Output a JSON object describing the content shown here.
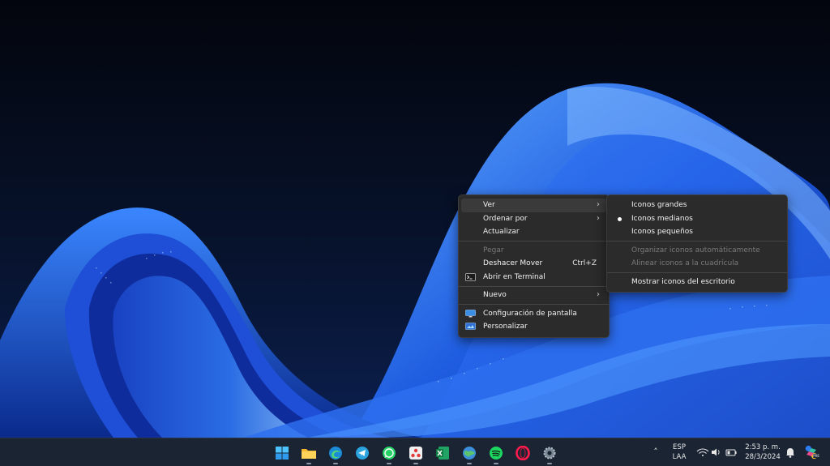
{
  "context_menu": {
    "items": [
      {
        "label": "Ver",
        "has_submenu": true
      },
      {
        "label": "Ordenar por",
        "has_submenu": true
      },
      {
        "label": "Actualizar"
      },
      {
        "label": "Pegar",
        "disabled": true
      },
      {
        "label": "Deshacer Mover",
        "shortcut": "Ctrl+Z"
      },
      {
        "label": "Abrir en Terminal",
        "icon": "terminal-icon"
      },
      {
        "label": "Nuevo",
        "has_submenu": true
      },
      {
        "label": "Configuración de pantalla",
        "icon": "display-settings-icon"
      },
      {
        "label": "Personalizar",
        "icon": "personalize-icon"
      }
    ]
  },
  "submenu_ver": {
    "items": [
      {
        "label": "Iconos grandes"
      },
      {
        "label": "Iconos medianos",
        "selected": true
      },
      {
        "label": "Iconos pequeños"
      },
      {
        "label": "Organizar iconos automáticamente",
        "disabled": true
      },
      {
        "label": "Alinear iconos a la cuadrícula",
        "disabled": true
      },
      {
        "label": "Mostrar iconos del escritorio"
      }
    ]
  },
  "taskbar": {
    "apps": [
      {
        "name": "start-icon"
      },
      {
        "name": "file-explorer-icon"
      },
      {
        "name": "edge-icon"
      },
      {
        "name": "telegram-icon"
      },
      {
        "name": "whatsapp-icon"
      },
      {
        "name": "app-red-icon"
      },
      {
        "name": "excel-icon"
      },
      {
        "name": "globe-app-icon"
      },
      {
        "name": "spotify-icon"
      },
      {
        "name": "opera-icon"
      },
      {
        "name": "settings-icon"
      }
    ],
    "tray": {
      "lang_top": "ESP",
      "lang_bottom": "LAA",
      "time": "2:53 p. m.",
      "date": "28/3/2024"
    }
  },
  "colors": {
    "menu_bg": "#2b2b2b",
    "taskbar_bg": "#1a2433",
    "wallpaper_dark": "#050b1c",
    "wallpaper_blue": "#1f5de0"
  }
}
